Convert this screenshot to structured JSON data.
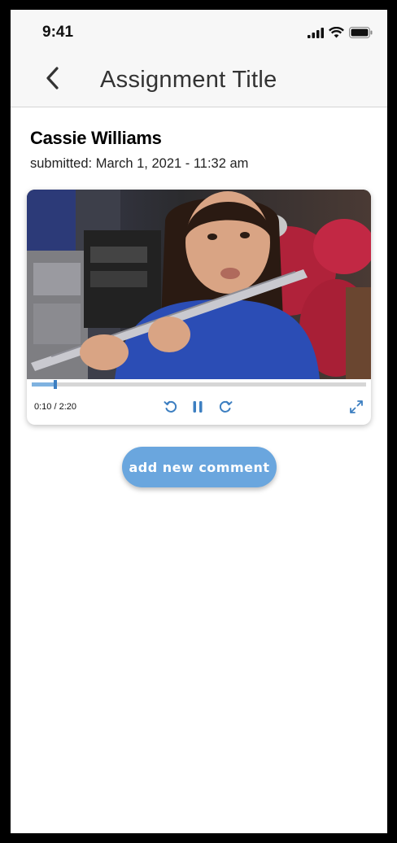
{
  "status_bar": {
    "time": "9:41",
    "icons": [
      "cellular-signal-icon",
      "wifi-icon",
      "battery-icon"
    ]
  },
  "nav": {
    "back_icon": "chevron-left-icon",
    "title": "Assignment Title"
  },
  "submission": {
    "student_name": "Cassie Williams",
    "submitted": "submitted: March 1, 2021 - 11:32 am"
  },
  "video": {
    "time_readout": "0:10 / 2:20",
    "progress_fraction": 0.0714,
    "controls": [
      "rewind-icon",
      "pause-icon",
      "forward-icon",
      "fullscreen-icon"
    ]
  },
  "actions": {
    "add_comment_label": "add new comment"
  },
  "colors": {
    "accent": "#6aa6de",
    "progress_fill": "#7fb2e0",
    "progress_thumb": "#3d7fc1",
    "header_bg": "#f7f7f7"
  }
}
